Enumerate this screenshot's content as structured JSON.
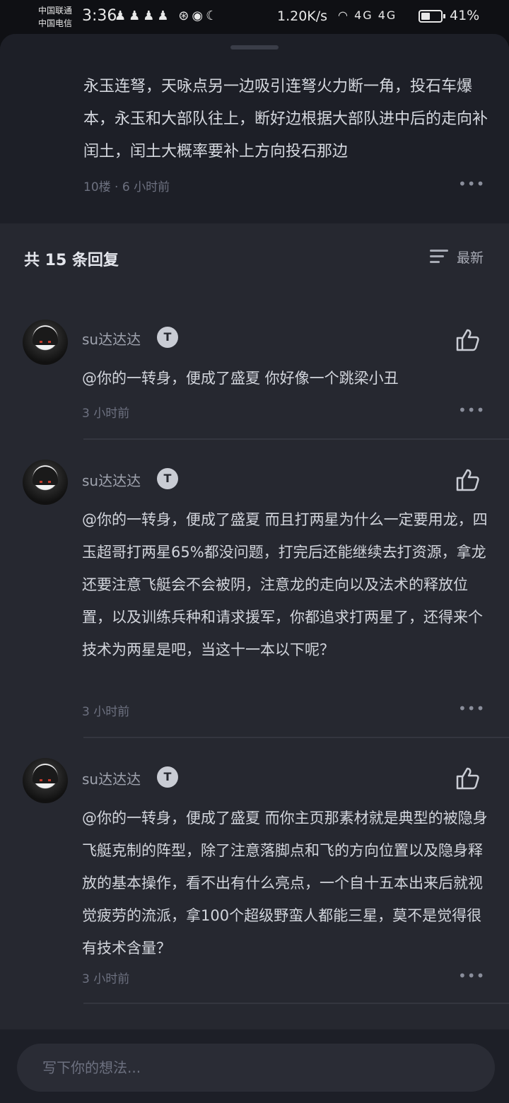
{
  "status_bar": {
    "carrier1": "中国联通",
    "carrier2": "中国电信",
    "time": "3:36",
    "speed": "1.20K/s",
    "network": "4G 4G",
    "battery": "41%"
  },
  "top_comment": {
    "text": "永玉连弩，天咏点另一边吸引连弩火力断一角，投石车爆本，永玉和大部队往上，断好边根据大部队进中后的走向补闰土，闰土大概率要补上方向投石那边",
    "meta": "10楼 · 6 小时前",
    "more": "•••"
  },
  "replies_header": {
    "title": "共 15 条回复",
    "sort_label": "最新"
  },
  "replies": [
    {
      "username": "su达达达",
      "badge": "T",
      "text": "@你的一转身，便成了盛夏 你好像一个跳梁小丑",
      "time": "3 小时前",
      "more": "•••"
    },
    {
      "username": "su达达达",
      "badge": "T",
      "text": "@你的一转身，便成了盛夏 而且打两星为什么一定要用龙，四玉超哥打两星65%都没问题，打完后还能继续去打资源，拿龙还要注意飞艇会不会被阴，注意龙的走向以及法术的释放位置，以及训练兵种和请求援军，你都追求打两星了，还得来个技术为两星是吧，当这十一本以下呢？",
      "time": "3 小时前",
      "more": "•••"
    },
    {
      "username": "su达达达",
      "badge": "T",
      "text": "@你的一转身，便成了盛夏 而你主页那素材就是典型的被隐身飞艇克制的阵型，除了注意落脚点和飞的方向位置以及隐身释放的基本操作，看不出有什么亮点，一个自十五本出来后就视觉疲劳的流派，拿100个超级野蛮人都能三星，莫不是觉得很有技术含量？",
      "time": "3 小时前",
      "more": "•••"
    }
  ],
  "input": {
    "placeholder": "写下你的想法..."
  }
}
